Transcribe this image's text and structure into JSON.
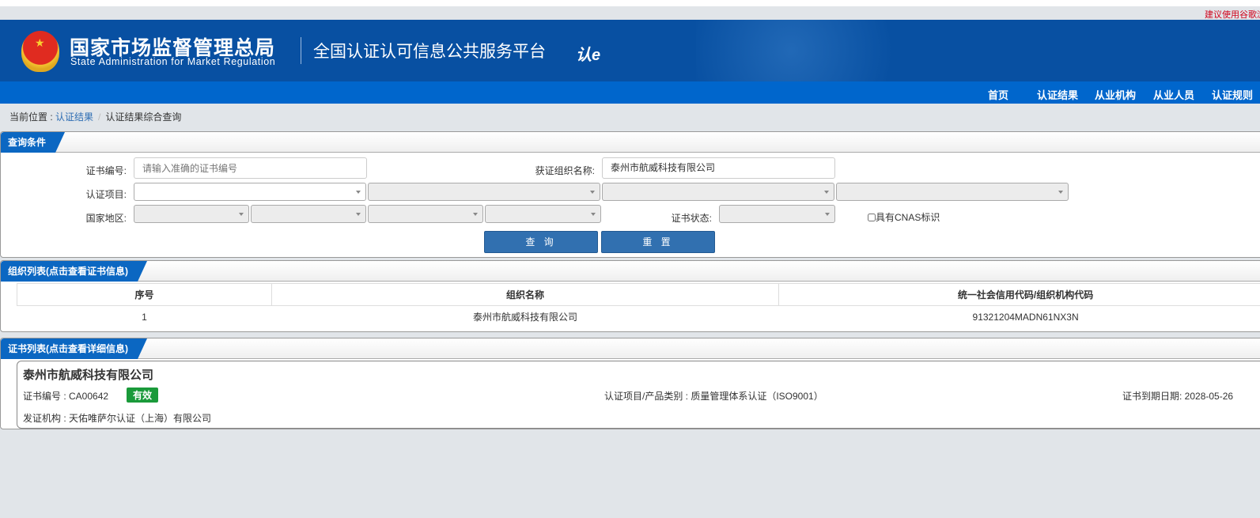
{
  "top_tip": "建议使用谷歌浏览器",
  "header": {
    "agency_cn": "国家市场监督管理总局",
    "agency_en": "State Administration  for  Market Regulation",
    "platform": "全国认证认可信息公共服务平台",
    "logo_text": "认e云"
  },
  "nav": [
    {
      "label": "首页"
    },
    {
      "label": "认证结果"
    },
    {
      "label": "从业机构"
    },
    {
      "label": "从业人员"
    },
    {
      "label": "认证规则"
    }
  ],
  "breadcrumb": {
    "prefix": "当前位置 :",
    "link": "认证结果",
    "current": "认证结果综合查询"
  },
  "query": {
    "title": "查询条件",
    "cert_no_label": "证书编号:",
    "cert_no_placeholder": "请输入准确的证书编号",
    "cert_no_value": "",
    "org_label": "获证组织名称:",
    "org_value": "泰州市航威科技有限公司",
    "project_label": "认证项目:",
    "region_label": "国家地区:",
    "status_label": "证书状态:",
    "cnas_label": "具有CNAS标识",
    "search_label": "查 询",
    "reset_label": "重 置"
  },
  "org_list": {
    "title": "组织列表(点击查看证书信息)",
    "columns": [
      "序号",
      "组织名称",
      "统一社会信用代码/组织机构代码"
    ],
    "rows": [
      [
        "1",
        "泰州市航威科技有限公司",
        "91321204MADN61NX3N"
      ]
    ]
  },
  "cert_list": {
    "title": "证书列表(点击查看详细信息)",
    "items": [
      {
        "org": "泰州市航威科技有限公司",
        "cert_no_label": "证书编号 :",
        "cert_no": "CA00642",
        "status": "有效",
        "project": "认证项目/产品类别 : 质量管理体系认证（ISO9001）",
        "expiry": "证书到期日期: 2028-05-26",
        "issuer": "发证机构 : 天佑唯萨尔认证（上海）有限公司"
      }
    ]
  },
  "colors": {
    "header": "#0850a2",
    "nav": "#0066cc",
    "valid": "#1a9a3a"
  }
}
